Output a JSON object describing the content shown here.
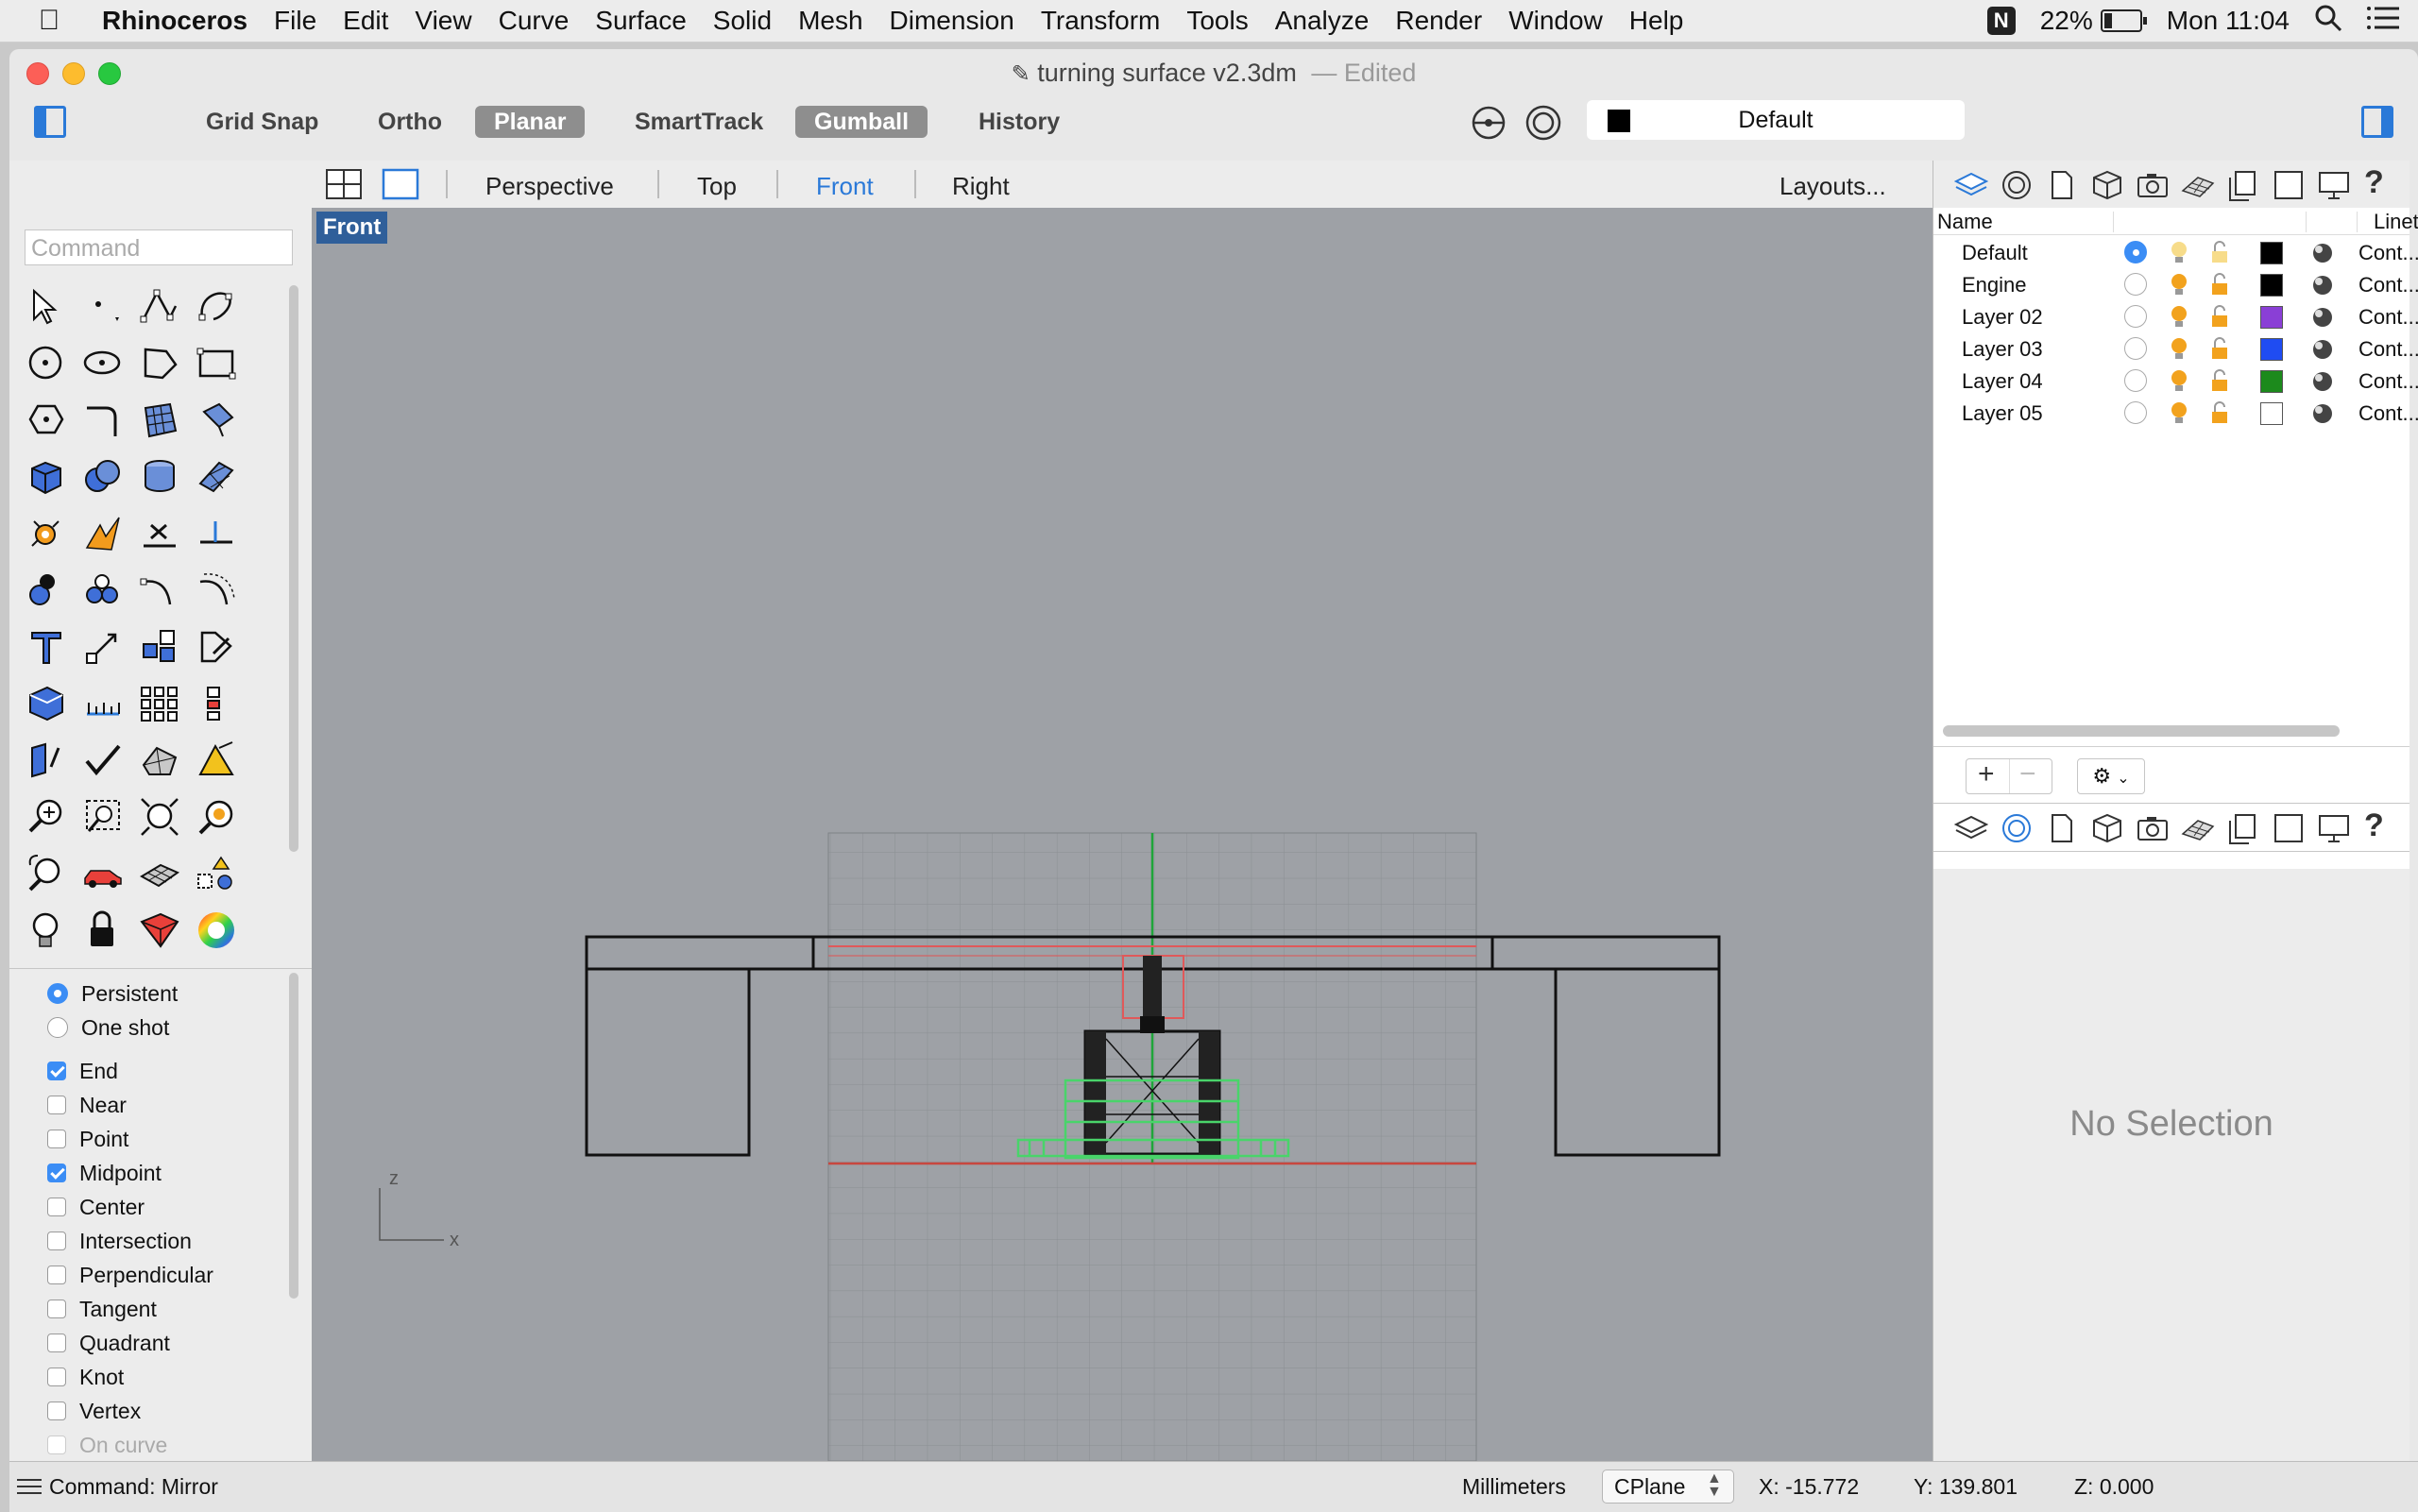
{
  "menubar": {
    "app_name": "Rhinoceros",
    "items": [
      "File",
      "Edit",
      "View",
      "Curve",
      "Surface",
      "Solid",
      "Mesh",
      "Dimension",
      "Transform",
      "Tools",
      "Analyze",
      "Render",
      "Window",
      "Help"
    ],
    "battery": "22%",
    "clock": "Mon 11:04"
  },
  "window": {
    "title": "turning surface v2.3dm",
    "title_suffix": "— Edited"
  },
  "toolbar": {
    "grid_snap": "Grid Snap",
    "ortho": "Ortho",
    "planar": "Planar",
    "smarttrack": "SmartTrack",
    "gumball": "Gumball",
    "history": "History",
    "current_layer": "Default"
  },
  "command": {
    "placeholder": "Command"
  },
  "viewport_tabs": {
    "tabs": [
      "Perspective",
      "Top",
      "Front",
      "Right"
    ],
    "active": "Front",
    "layouts": "Layouts...",
    "viewport_label": "Front",
    "axis_z": "z",
    "axis_x": "x"
  },
  "osnap": {
    "persistent": "Persistent",
    "one_shot": "One shot",
    "items": [
      {
        "label": "End",
        "checked": true
      },
      {
        "label": "Near",
        "checked": false
      },
      {
        "label": "Point",
        "checked": false
      },
      {
        "label": "Midpoint",
        "checked": true
      },
      {
        "label": "Center",
        "checked": false
      },
      {
        "label": "Intersection",
        "checked": false
      },
      {
        "label": "Perpendicular",
        "checked": false
      },
      {
        "label": "Tangent",
        "checked": false
      },
      {
        "label": "Quadrant",
        "checked": false
      },
      {
        "label": "Knot",
        "checked": false
      },
      {
        "label": "Vertex",
        "checked": false
      },
      {
        "label": "On curve",
        "checked": false
      }
    ]
  },
  "layers": {
    "col_name": "Name",
    "col_linetype": "Linety",
    "rows": [
      {
        "name": "Default",
        "current": true,
        "color": "#000000",
        "linetype": "Cont..."
      },
      {
        "name": "Engine",
        "current": false,
        "color": "#000000",
        "linetype": "Cont..."
      },
      {
        "name": "Layer 02",
        "current": false,
        "color": "#8a3fd6",
        "linetype": "Cont..."
      },
      {
        "name": "Layer 03",
        "current": false,
        "color": "#1f4cf2",
        "linetype": "Cont..."
      },
      {
        "name": "Layer 04",
        "current": false,
        "color": "#1c8a1c",
        "linetype": "Cont..."
      },
      {
        "name": "Layer 05",
        "current": false,
        "color": "#ffffff",
        "linetype": "Cont..."
      }
    ]
  },
  "properties": {
    "no_selection": "No Selection"
  },
  "status": {
    "command": "Command: Mirror",
    "units": "Millimeters",
    "cplane": "CPlane",
    "x": "X: -15.772",
    "y": "Y: 139.801",
    "z": "Z: 0.000"
  },
  "colors": {
    "accent": "#3b8df5",
    "viewport_bg": "#9ea1a6",
    "active_tab": "#2a79d8"
  }
}
